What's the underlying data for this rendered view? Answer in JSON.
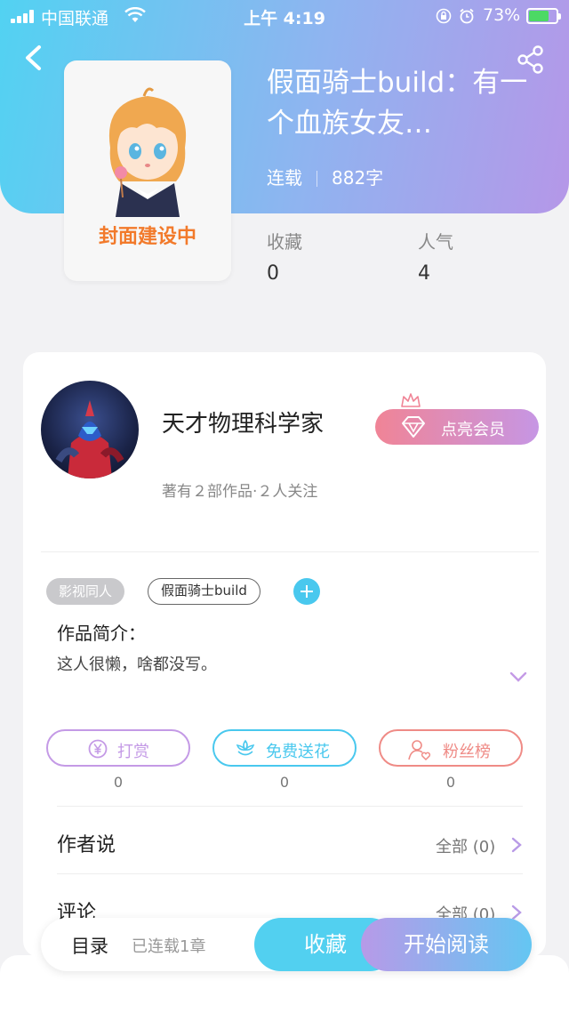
{
  "status_bar": {
    "carrier": "中国联通",
    "time": "上午 4:19",
    "battery_percent": "73%",
    "battery_level": 0.73
  },
  "book": {
    "title": "假面骑士build：有一个血族女友…",
    "status": "连载",
    "word_count": "882字",
    "cover_text": "封面建设中",
    "stats": [
      {
        "label": "收藏",
        "value": "0"
      },
      {
        "label": "人气",
        "value": "4"
      }
    ]
  },
  "author": {
    "name": "天才物理科学家",
    "subtitle": "著有２部作品·２人关注",
    "vip_button": "点亮会员"
  },
  "tags": {
    "category": "影视同人",
    "tag": "假面骑士build"
  },
  "intro": {
    "title": "作品简介：",
    "text": "这人很懒，啥都没写。"
  },
  "actions": [
    {
      "label": "打赏",
      "count": "0",
      "color": "#c49ae6",
      "icon": "yen-coin-icon"
    },
    {
      "label": "免费送花",
      "count": "0",
      "color": "#49c8ee",
      "icon": "flower-icon"
    },
    {
      "label": "粉丝榜",
      "count": "0",
      "color": "#ef8b86",
      "icon": "fan-person-icon"
    }
  ],
  "sections": [
    {
      "title": "作者说",
      "link": "全部 (0)"
    },
    {
      "title": "评论",
      "link": "全部 (0)"
    }
  ],
  "bottom_bar": {
    "toc_label": "目录",
    "toc_status": "已连载1章",
    "collect_label": "收藏",
    "read_label": "开始阅读"
  },
  "colors": {
    "header_gradient_start": "#52d2f2",
    "header_gradient_end": "#b597e8",
    "accent_cyan": "#52d0f0",
    "accent_purple": "#b79ae8"
  }
}
